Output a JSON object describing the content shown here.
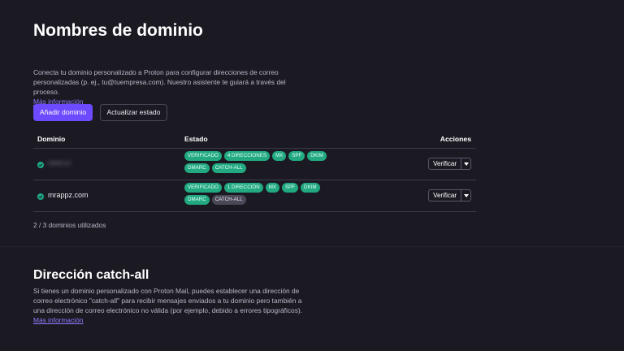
{
  "header": {
    "title": "Nombres de dominio"
  },
  "intro": {
    "text": "Conecta tu dominio personalizado a Proton para configurar direcciones de correo personalizadas (p. ej., tu@tuempresa.com). Nuestro asistente te guiará a través del proceso.",
    "link": "Más información"
  },
  "toolbar": {
    "add_label": "Añadir dominio",
    "refresh_label": "Actualizar estado"
  },
  "table": {
    "headers": {
      "domain": "Dominio",
      "status": "Estado",
      "actions": "Acciones"
    },
    "rows": [
      {
        "domain": "••••••.••",
        "blurred": true,
        "badges": [
          "VERIFICADO",
          "4 DIRECCIONES",
          "MX",
          "SPF",
          "DKIM",
          "DMARC",
          "CATCH-ALL"
        ],
        "action": "Verificar"
      },
      {
        "domain": "mrappz.com",
        "blurred": false,
        "badges": [
          "VERIFICADO",
          "1 DIRECCIÓN",
          "MX",
          "SPF",
          "DKIM",
          "DMARC",
          "CATCH-ALL"
        ],
        "action": "Verificar"
      }
    ]
  },
  "usage": "2 / 3 dominios utilizados",
  "catchall": {
    "title": "Dirección catch-all",
    "text": "Si tienes un dominio personalizado con Proton Mail, puedes establecer una dirección de correo electrónico \"catch-all\" para recibir mensajes enviados a tu dominio pero también a una dirección de correo electrónico no válida (por ejemplo, debido a errores tipográficos).",
    "link": "Más información"
  },
  "colors": {
    "accent": "#6d4aff",
    "success": "#22a982",
    "background": "#1b1a23"
  }
}
